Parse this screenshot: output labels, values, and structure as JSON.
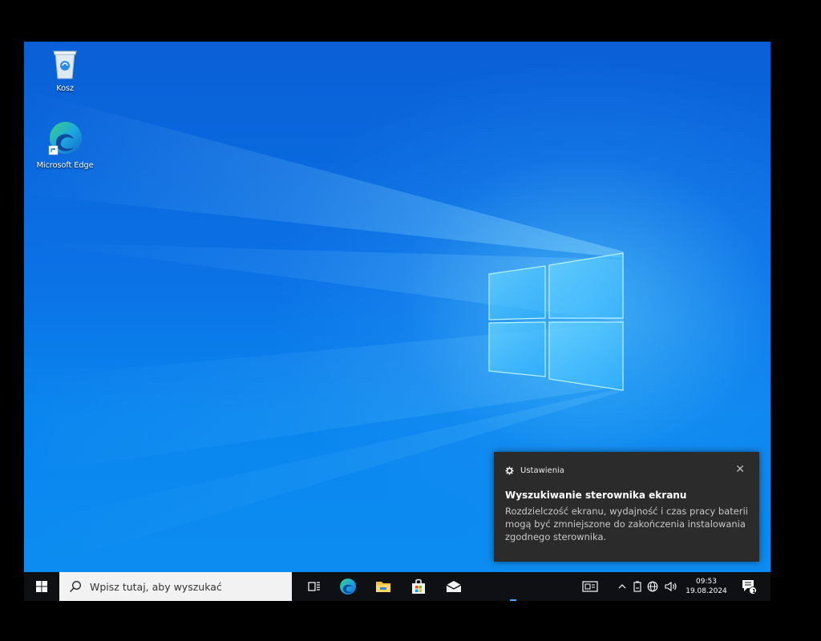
{
  "desktop": {
    "icons": [
      {
        "label": "Kosz",
        "icon": "recycle-bin-icon"
      },
      {
        "label": "Microsoft Edge",
        "icon": "edge-icon"
      }
    ]
  },
  "notification": {
    "app": "Ustawienia",
    "title": "Wyszukiwanie sterownika ekranu",
    "body": "Rozdzielczość ekranu, wydajność i czas pracy baterii mogą być zmniejszone do zakończenia instalowania zgodnego sterownika.",
    "close_glyph": "✕"
  },
  "taskbar": {
    "search_placeholder": "Wpisz tutaj, aby wyszukać",
    "pinned": [
      "task-view-icon",
      "edge-icon",
      "file-explorer-icon",
      "store-icon",
      "mail-icon"
    ],
    "tray": {
      "time": "09:53",
      "date": "19.08.2024",
      "notification_count": "1"
    }
  },
  "colors": {
    "wallpaper_blue": "#0a63d8",
    "taskbar": "#0f1013",
    "toast_bg": "#2b2b2b"
  }
}
